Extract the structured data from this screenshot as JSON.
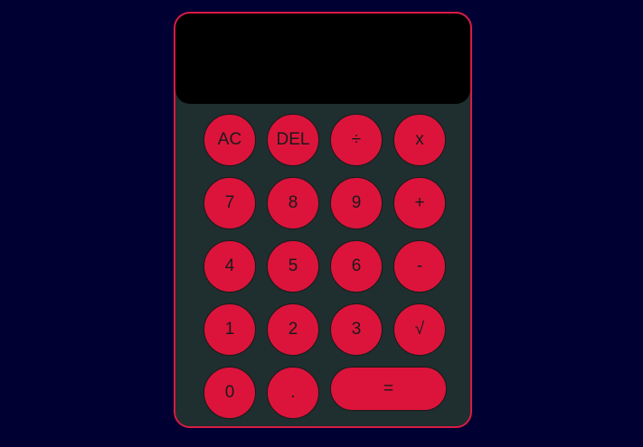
{
  "display": {
    "previous": "",
    "current": ""
  },
  "keys": {
    "ac": "AC",
    "del": "DEL",
    "divide": "÷",
    "multiply": "x",
    "seven": "7",
    "eight": "8",
    "nine": "9",
    "plus": "+",
    "four": "4",
    "five": "5",
    "six": "6",
    "minus": "-",
    "one": "1",
    "two": "2",
    "three": "3",
    "sqrt": "√",
    "zero": "0",
    "dot": ".",
    "equals": "="
  },
  "colors": {
    "background": "#000033",
    "body": "#1f2e2e",
    "accent": "#dc143c",
    "display": "#000000"
  }
}
